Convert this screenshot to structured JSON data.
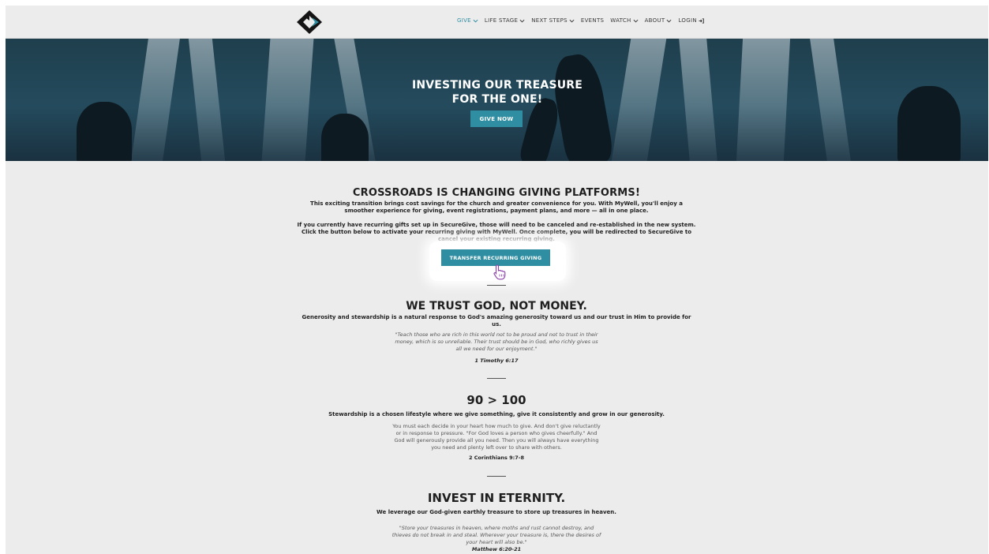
{
  "header": {
    "logo_icon": "crossroads-logo-icon",
    "nav": [
      {
        "label": "GIVE",
        "dropdown": true,
        "active": true
      },
      {
        "label": "LIFE STAGE",
        "dropdown": true
      },
      {
        "label": "NEXT STEPS",
        "dropdown": true
      },
      {
        "label": "EVENTS",
        "dropdown": false
      },
      {
        "label": "WATCH",
        "dropdown": true
      },
      {
        "label": "ABOUT",
        "dropdown": true
      },
      {
        "label": "LOGIN",
        "dropdown": false,
        "icon": "login-icon"
      }
    ]
  },
  "hero": {
    "title_line1": "INVESTING OUR TREASURE",
    "title_line2": "FOR THE ONE!",
    "button": "GIVE NOW"
  },
  "platform": {
    "title": "CROSSROADS IS CHANGING GIVING PLATFORMS!",
    "para1_line1": "This exciting transition brings cost savings for the church and greater convenience for you. With MyWell, you'll enjoy a",
    "para1_line2": "smoother experience for giving, event registrations, payment plans, and more — all in one place.",
    "para2_line1": "If you currently have recurring gifts set up in SecureGive, those will need to be canceled and re-established in the new system.",
    "para2_line2": "Click the button below to activate your recurring giving with MyWell. Once complete, you will be redirected to SecureGive to",
    "para2_line3": "cancel your existing recurring giving.",
    "button": "TRANSFER RECURRING GIVING"
  },
  "trust": {
    "title": "WE TRUST GOD, NOT MONEY.",
    "sub_line1": "Generosity and stewardship is a natural response to God's amazing generosity toward us and our trust in Him to provide for",
    "sub_line2": "us.",
    "quote_line1": "\"Teach those who are rich in this world not to be proud and not to trust in their",
    "quote_line2": "money, which is so unreliable. Their trust should be in God, who richly gives us",
    "quote_line3": "all we need for our enjoyment.\"",
    "ref": "1 Timothy 6:17"
  },
  "ninety": {
    "title": "90 > 100",
    "sub": "Stewardship is a chosen lifestyle where we give something, give it consistently and grow in our generosity.",
    "quote_line1": "You must each decide in your heart how much to give. And don't give reluctantly",
    "quote_line2": "or in response to pressure. \"For God loves a person who gives cheerfully.\" And",
    "quote_line3": "God will generously provide all you need. Then you will always have everything",
    "quote_line4": "you need and plenty left over to share with others.",
    "ref": "2 Corinthians 9:7-8"
  },
  "eternity": {
    "title": "INVEST IN ETERNITY.",
    "sub": "We leverage our God-given earthly treasure to store up treasures in heaven.",
    "quote_line1": "\"Store your treasures in heaven, where moths and rust cannot destroy, and",
    "quote_line2": "thieves do not break in and steal. Wherever your treasure is, there the desires of",
    "quote_line3": "your heart will also be.\"",
    "ref": "Matthew 6:20-21"
  },
  "colors": {
    "accent": "#2f8ea1",
    "background": "#ececec",
    "text": "#222222"
  }
}
